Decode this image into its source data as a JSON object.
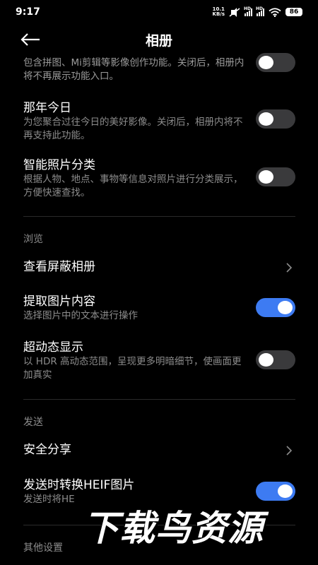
{
  "status_bar": {
    "time": "9:17",
    "net_speed_value": "10.1",
    "net_speed_unit": "KB/s",
    "sim1_label": "HD",
    "sim2_label": "HD",
    "battery": "86"
  },
  "header": {
    "title": "相册"
  },
  "items": {
    "creative": {
      "desc": "包含拼图、Mi剪辑等影像创作功能。关闭后，相册内将不再展示功能入口。"
    },
    "on_this_day": {
      "title": "那年今日",
      "desc": "为您聚合过往今日的美好影像。关闭后，相册内将不再支持此功能。"
    },
    "smart_classify": {
      "title": "智能照片分类",
      "desc": "根据人物、地点、事物等信息对照片进行分类展示，方便快速查找。"
    },
    "browse_section": "浏览",
    "hidden_album": {
      "title": "查看屏蔽相册"
    },
    "extract_content": {
      "title": "提取图片内容",
      "desc": "选择图片中的文本进行操作"
    },
    "hdr_display": {
      "title": "超动态显示",
      "desc": "以 HDR 高动态范围，呈现更多明暗细节，使画面更加真实"
    },
    "send_section": "发送",
    "safe_share": {
      "title": "安全分享"
    },
    "heif_convert": {
      "title": "发送时转换HEIF图片",
      "desc": "发送时将HE"
    },
    "other_section": "其他设置"
  },
  "toggles": {
    "creative": false,
    "on_this_day": false,
    "smart_classify": false,
    "extract_content": true,
    "hdr_display": false,
    "heif_convert": true
  },
  "watermark": "下载鸟资源",
  "colors": {
    "background": "#000000",
    "accent": "#3d7bf2",
    "toggle_off": "#3a3a3c",
    "secondary_text": "#8c8c8c"
  },
  "icons": {
    "back": "back-arrow-icon",
    "chevron": "chevron-right-icon",
    "wifi": "wifi-icon",
    "signal": "signal-icon",
    "mute": "mute-icon"
  }
}
